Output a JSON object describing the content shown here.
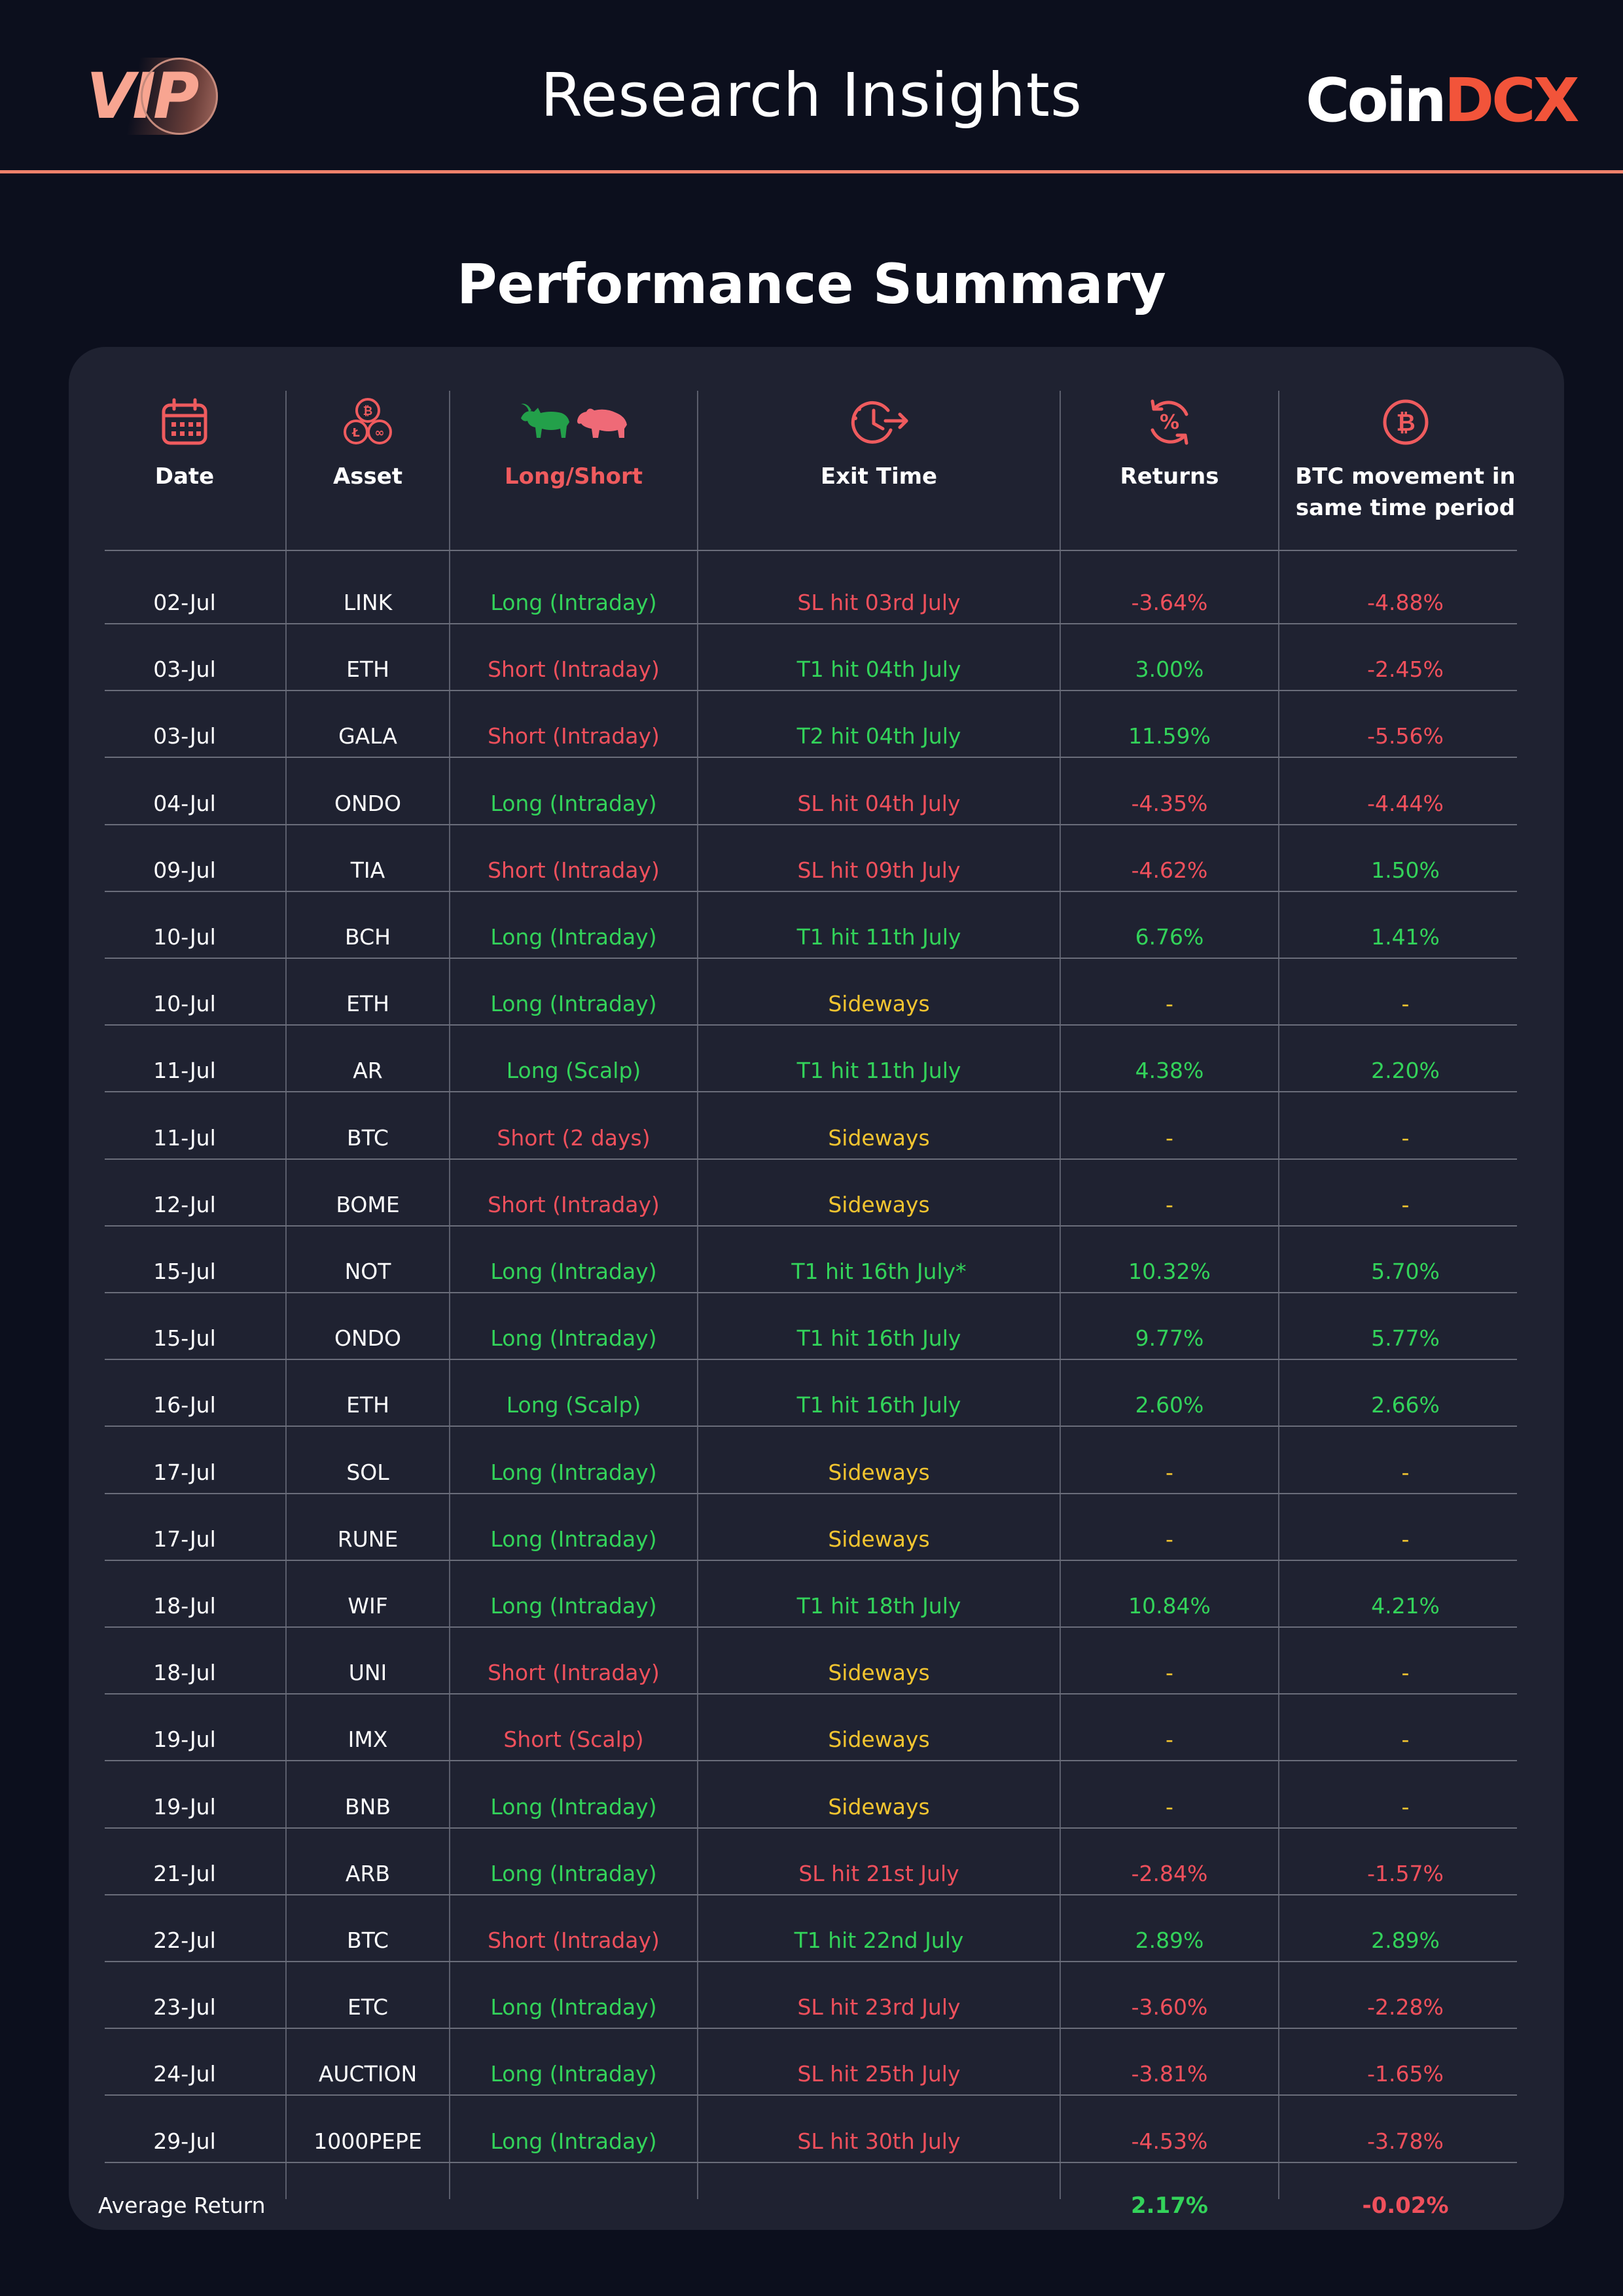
{
  "header": {
    "vip_logo": "VIP",
    "title": "Research Insights",
    "brand_coin": "Coin",
    "brand_dcx": "DCX"
  },
  "section_title": "Performance Summary",
  "columns": {
    "date": "Date",
    "asset": "Asset",
    "long_short": "Long/Short",
    "exit_time": "Exit Time",
    "returns": "Returns",
    "btc_movement_line1": "BTC movement in",
    "btc_movement_line2": "same time period"
  },
  "colors": {
    "background": "#0c0f1d",
    "panel": "#1f2231",
    "accent": "#f0816b",
    "positive": "#33d35a",
    "negative": "#f0505c",
    "neutral": "#f3c530"
  },
  "rows": [
    {
      "date": "02-Jul",
      "asset": "LINK",
      "position": "Long (Intraday)",
      "position_tone": "green",
      "exit": "SL hit 03rd July",
      "exit_tone": "red",
      "returns": "-3.64%",
      "returns_tone": "red",
      "btc": "-4.88%",
      "btc_tone": "red"
    },
    {
      "date": "03-Jul",
      "asset": "ETH",
      "position": "Short (Intraday)",
      "position_tone": "red",
      "exit": "T1 hit 04th July",
      "exit_tone": "green",
      "returns": "3.00%",
      "returns_tone": "green",
      "btc": "-2.45%",
      "btc_tone": "red"
    },
    {
      "date": "03-Jul",
      "asset": "GALA",
      "position": "Short (Intraday)",
      "position_tone": "red",
      "exit": "T2 hit 04th July",
      "exit_tone": "green",
      "returns": "11.59%",
      "returns_tone": "green",
      "btc": "-5.56%",
      "btc_tone": "red"
    },
    {
      "date": "04-Jul",
      "asset": "ONDO",
      "position": "Long (Intraday)",
      "position_tone": "green",
      "exit": "SL hit 04th July",
      "exit_tone": "red",
      "returns": "-4.35%",
      "returns_tone": "red",
      "btc": "-4.44%",
      "btc_tone": "red"
    },
    {
      "date": "09-Jul",
      "asset": "TIA",
      "position": "Short (Intraday)",
      "position_tone": "red",
      "exit": "SL hit 09th July",
      "exit_tone": "red",
      "returns": "-4.62%",
      "returns_tone": "red",
      "btc": "1.50%",
      "btc_tone": "green"
    },
    {
      "date": "10-Jul",
      "asset": "BCH",
      "position": "Long (Intraday)",
      "position_tone": "green",
      "exit": "T1 hit 11th July",
      "exit_tone": "green",
      "returns": "6.76%",
      "returns_tone": "green",
      "btc": "1.41%",
      "btc_tone": "green"
    },
    {
      "date": "10-Jul",
      "asset": "ETH",
      "position": "Long (Intraday)",
      "position_tone": "green",
      "exit": "Sideways",
      "exit_tone": "yellow",
      "returns": "-",
      "returns_tone": "yellow",
      "btc": "-",
      "btc_tone": "yellow"
    },
    {
      "date": "11-Jul",
      "asset": "AR",
      "position": "Long (Scalp)",
      "position_tone": "green",
      "exit": "T1 hit 11th July",
      "exit_tone": "green",
      "returns": "4.38%",
      "returns_tone": "green",
      "btc": "2.20%",
      "btc_tone": "green"
    },
    {
      "date": "11-Jul",
      "asset": "BTC",
      "position": "Short (2 days)",
      "position_tone": "red",
      "exit": "Sideways",
      "exit_tone": "yellow",
      "returns": "-",
      "returns_tone": "yellow",
      "btc": "-",
      "btc_tone": "yellow"
    },
    {
      "date": "12-Jul",
      "asset": "BOME",
      "position": "Short (Intraday)",
      "position_tone": "red",
      "exit": "Sideways",
      "exit_tone": "yellow",
      "returns": "-",
      "returns_tone": "yellow",
      "btc": "-",
      "btc_tone": "yellow"
    },
    {
      "date": "15-Jul",
      "asset": "NOT",
      "position": "Long (Intraday)",
      "position_tone": "green",
      "exit": "T1 hit 16th July*",
      "exit_tone": "green",
      "returns": "10.32%",
      "returns_tone": "green",
      "btc": "5.70%",
      "btc_tone": "green"
    },
    {
      "date": "15-Jul",
      "asset": "ONDO",
      "position": "Long (Intraday)",
      "position_tone": "green",
      "exit": "T1 hit 16th July",
      "exit_tone": "green",
      "returns": "9.77%",
      "returns_tone": "green",
      "btc": "5.77%",
      "btc_tone": "green"
    },
    {
      "date": "16-Jul",
      "asset": "ETH",
      "position": "Long (Scalp)",
      "position_tone": "green",
      "exit": "T1 hit 16th July",
      "exit_tone": "green",
      "returns": "2.60%",
      "returns_tone": "green",
      "btc": "2.66%",
      "btc_tone": "green"
    },
    {
      "date": "17-Jul",
      "asset": "SOL",
      "position": "Long (Intraday)",
      "position_tone": "green",
      "exit": "Sideways",
      "exit_tone": "yellow",
      "returns": "-",
      "returns_tone": "yellow",
      "btc": "-",
      "btc_tone": "yellow"
    },
    {
      "date": "17-Jul",
      "asset": "RUNE",
      "position": "Long (Intraday)",
      "position_tone": "green",
      "exit": "Sideways",
      "exit_tone": "yellow",
      "returns": "-",
      "returns_tone": "yellow",
      "btc": "-",
      "btc_tone": "yellow"
    },
    {
      "date": "18-Jul",
      "asset": "WIF",
      "position": "Long (Intraday)",
      "position_tone": "green",
      "exit": "T1 hit 18th July",
      "exit_tone": "green",
      "returns": "10.84%",
      "returns_tone": "green",
      "btc": "4.21%",
      "btc_tone": "green"
    },
    {
      "date": "18-Jul",
      "asset": "UNI",
      "position": "Short (Intraday)",
      "position_tone": "red",
      "exit": "Sideways",
      "exit_tone": "yellow",
      "returns": "-",
      "returns_tone": "yellow",
      "btc": "-",
      "btc_tone": "yellow"
    },
    {
      "date": "19-Jul",
      "asset": "IMX",
      "position": "Short (Scalp)",
      "position_tone": "red",
      "exit": "Sideways",
      "exit_tone": "yellow",
      "returns": "-",
      "returns_tone": "yellow",
      "btc": "-",
      "btc_tone": "yellow"
    },
    {
      "date": "19-Jul",
      "asset": "BNB",
      "position": "Long (Intraday)",
      "position_tone": "green",
      "exit": "Sideways",
      "exit_tone": "yellow",
      "returns": "-",
      "returns_tone": "yellow",
      "btc": "-",
      "btc_tone": "yellow"
    },
    {
      "date": "21-Jul",
      "asset": "ARB",
      "position": "Long (Intraday)",
      "position_tone": "green",
      "exit": "SL hit 21st July",
      "exit_tone": "red",
      "returns": "-2.84%",
      "returns_tone": "red",
      "btc": "-1.57%",
      "btc_tone": "red"
    },
    {
      "date": "22-Jul",
      "asset": "BTC",
      "position": "Short (Intraday)",
      "position_tone": "red",
      "exit": "T1 hit 22nd July",
      "exit_tone": "green",
      "returns": "2.89%",
      "returns_tone": "green",
      "btc": "2.89%",
      "btc_tone": "green"
    },
    {
      "date": "23-Jul",
      "asset": "ETC",
      "position": "Long (Intraday)",
      "position_tone": "green",
      "exit": "SL hit 23rd July",
      "exit_tone": "red",
      "returns": "-3.60%",
      "returns_tone": "red",
      "btc": "-2.28%",
      "btc_tone": "red"
    },
    {
      "date": "24-Jul",
      "asset": "AUCTION",
      "position": "Long (Intraday)",
      "position_tone": "green",
      "exit": "SL hit 25th July",
      "exit_tone": "red",
      "returns": "-3.81%",
      "returns_tone": "red",
      "btc": "-1.65%",
      "btc_tone": "red"
    },
    {
      "date": "29-Jul",
      "asset": "1000PEPE",
      "position": "Long (Intraday)",
      "position_tone": "green",
      "exit": "SL hit 30th July",
      "exit_tone": "red",
      "returns": "-4.53%",
      "returns_tone": "red",
      "btc": "-3.78%",
      "btc_tone": "red"
    }
  ],
  "average": {
    "label": "Average Return",
    "returns": "2.17%",
    "returns_tone": "green",
    "btc": "-0.02%",
    "btc_tone": "red"
  },
  "icons": {
    "date": "calendar-icon",
    "asset": "coins-icon",
    "long_short": "bull-bear-icon",
    "exit_time": "clock-exit-icon",
    "returns": "percent-cycle-icon",
    "btc": "bitcoin-icon"
  }
}
